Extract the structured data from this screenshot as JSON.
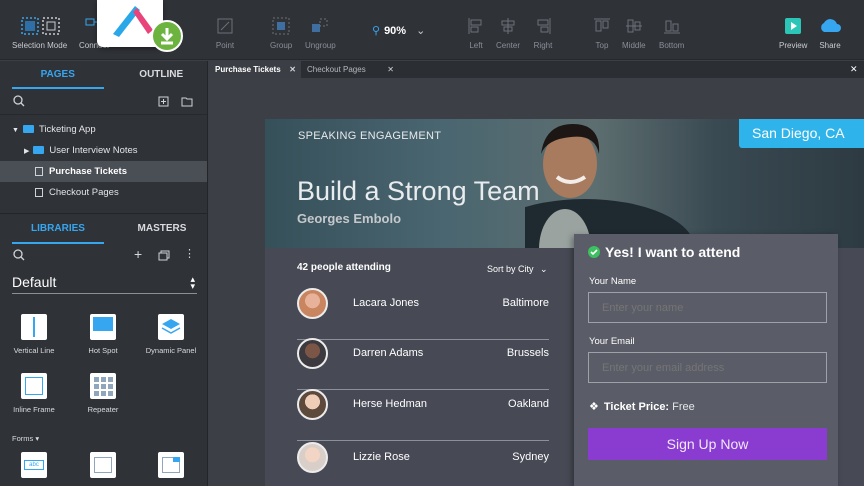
{
  "toolbar": {
    "selection_mode": "Selection Mode",
    "connect": "Connect",
    "point": "Point",
    "group": "Group",
    "ungroup": "Ungroup",
    "zoom": "90%",
    "left": "Left",
    "center": "Center",
    "right": "Right",
    "top": "Top",
    "middle": "Middle",
    "bottom": "Bottom",
    "preview": "Preview",
    "share": "Share"
  },
  "pages_panel": {
    "tab_pages": "PAGES",
    "tab_outline": "OUTLINE",
    "tree": [
      {
        "label": "Ticketing App",
        "type": "folder"
      },
      {
        "label": "User Interview Notes",
        "type": "folder"
      },
      {
        "label": "Purchase Tickets",
        "type": "page",
        "selected": true
      },
      {
        "label": "Checkout Pages",
        "type": "page"
      }
    ]
  },
  "libraries_panel": {
    "tab_libraries": "LIBRARIES",
    "tab_masters": "MASTERS",
    "library": "Default",
    "widgets": [
      "Vertical Line",
      "Hot Spot",
      "Dynamic Panel",
      "Inline Frame",
      "Repeater"
    ],
    "section": "Forms"
  },
  "doc_tabs": [
    "Purchase Tickets",
    "Checkout Pages"
  ],
  "design": {
    "eyebrow": "SPEAKING ENGAGEMENT",
    "title": "Build a Strong Team",
    "speaker": "Georges Embolo",
    "city": "San Diego, CA",
    "attending": "42 people attending",
    "sort": "Sort by City",
    "people": [
      {
        "name": "Lacara Jones",
        "city": "Baltimore"
      },
      {
        "name": "Darren Adams",
        "city": "Brussels"
      },
      {
        "name": "Herse Hedman",
        "city": "Oakland"
      },
      {
        "name": "Lizzie Rose",
        "city": "Sydney"
      }
    ],
    "form": {
      "heading": "Yes! I want to attend",
      "name_label": "Your Name",
      "name_placeholder": "Enter your name",
      "email_label": "Your Email",
      "email_placeholder": "Enter your email address",
      "price_label": "Ticket Price:",
      "price_value": "Free",
      "button": "Sign Up Now"
    }
  },
  "colors": {
    "accent": "#37a6f0",
    "button": "#8a3bd0",
    "city_badge": "#2eb4ea",
    "check": "#3dc060"
  }
}
